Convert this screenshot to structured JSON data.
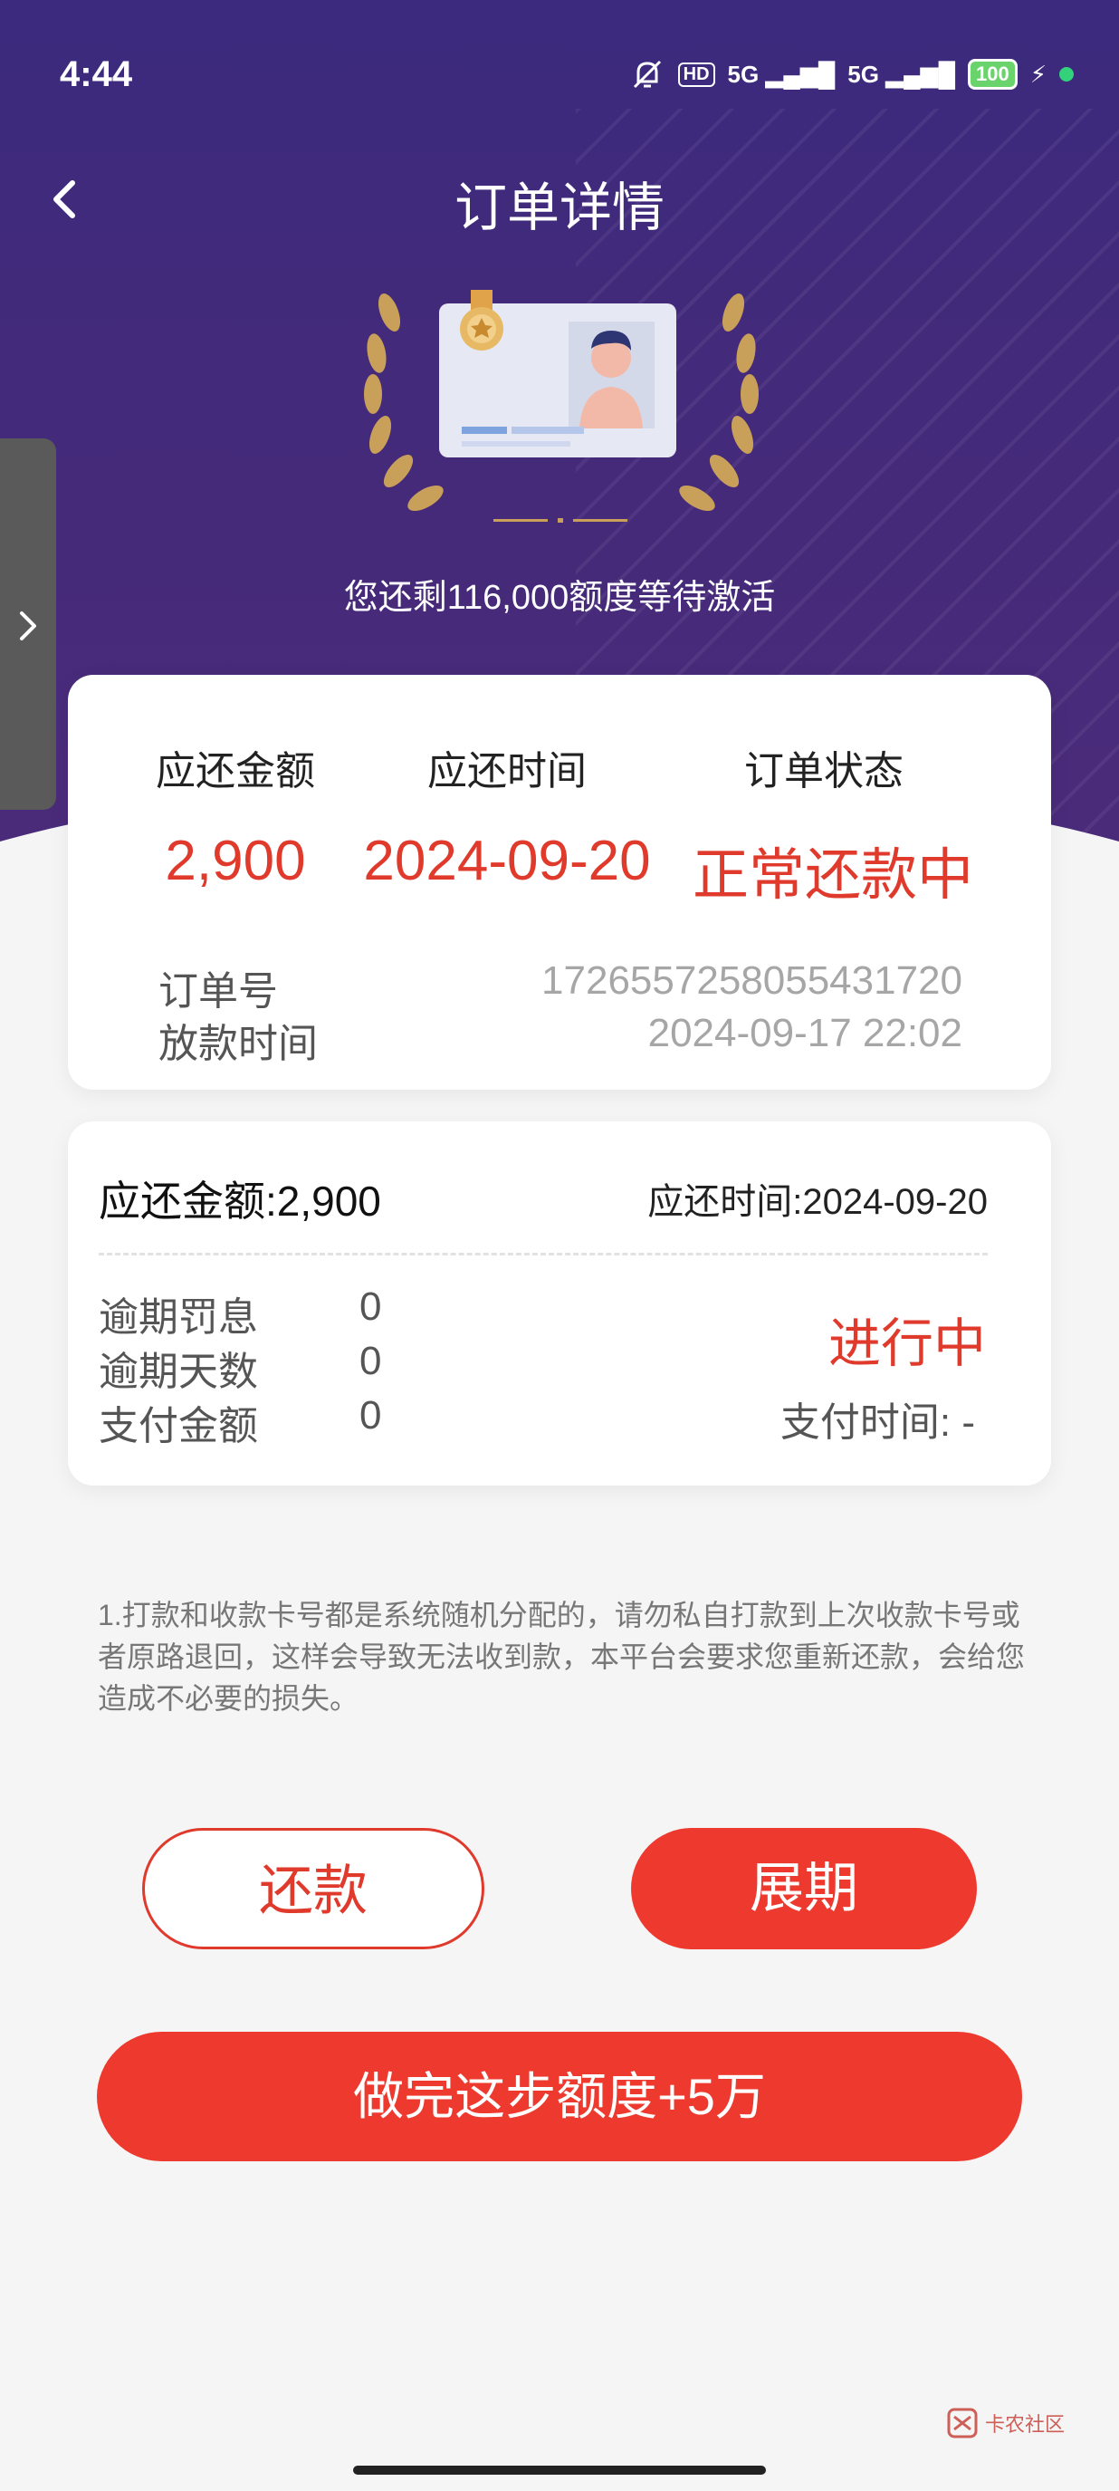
{
  "status_bar": {
    "time": "4:44",
    "signal1": "5G",
    "signal2": "5G",
    "hd": "HD",
    "battery": "100"
  },
  "header": {
    "title": "订单详情",
    "remaining_text": "您还剩116,000额度等待激活"
  },
  "summary_card": {
    "columns": [
      {
        "label": "应还金额",
        "value": "2,900"
      },
      {
        "label": "应还时间",
        "value": "2024-09-20"
      },
      {
        "label": "订单状态",
        "value": "正常还款中"
      }
    ],
    "order_no_label": "订单号",
    "order_no": "1726557258055431720",
    "loan_time_label": "放款时间",
    "loan_time": "2024-09-17 22:02"
  },
  "installment_card": {
    "amount": "应还金额:2,900",
    "due": "应还时间:2024-09-20",
    "rows": [
      {
        "label": "逾期罚息",
        "value": "0"
      },
      {
        "label": "逾期天数",
        "value": "0"
      },
      {
        "label": "支付金额",
        "value": "0"
      }
    ],
    "status": "进行中",
    "pay_time": "支付时间: -"
  },
  "notice": "1.打款和收款卡号都是系统随机分配的，请勿私自打款到上次收款卡号或者原路退回，这样会导致无法收到款，本平台会要求您重新还款，会给您造成不必要的损失。",
  "buttons": {
    "repay": "还款",
    "extend": "展期",
    "boost": "做完这步额度+5万"
  },
  "watermark": "卡农社区",
  "colors": {
    "accent": "#e03a2c",
    "header_bg": "#3b2a7e"
  }
}
